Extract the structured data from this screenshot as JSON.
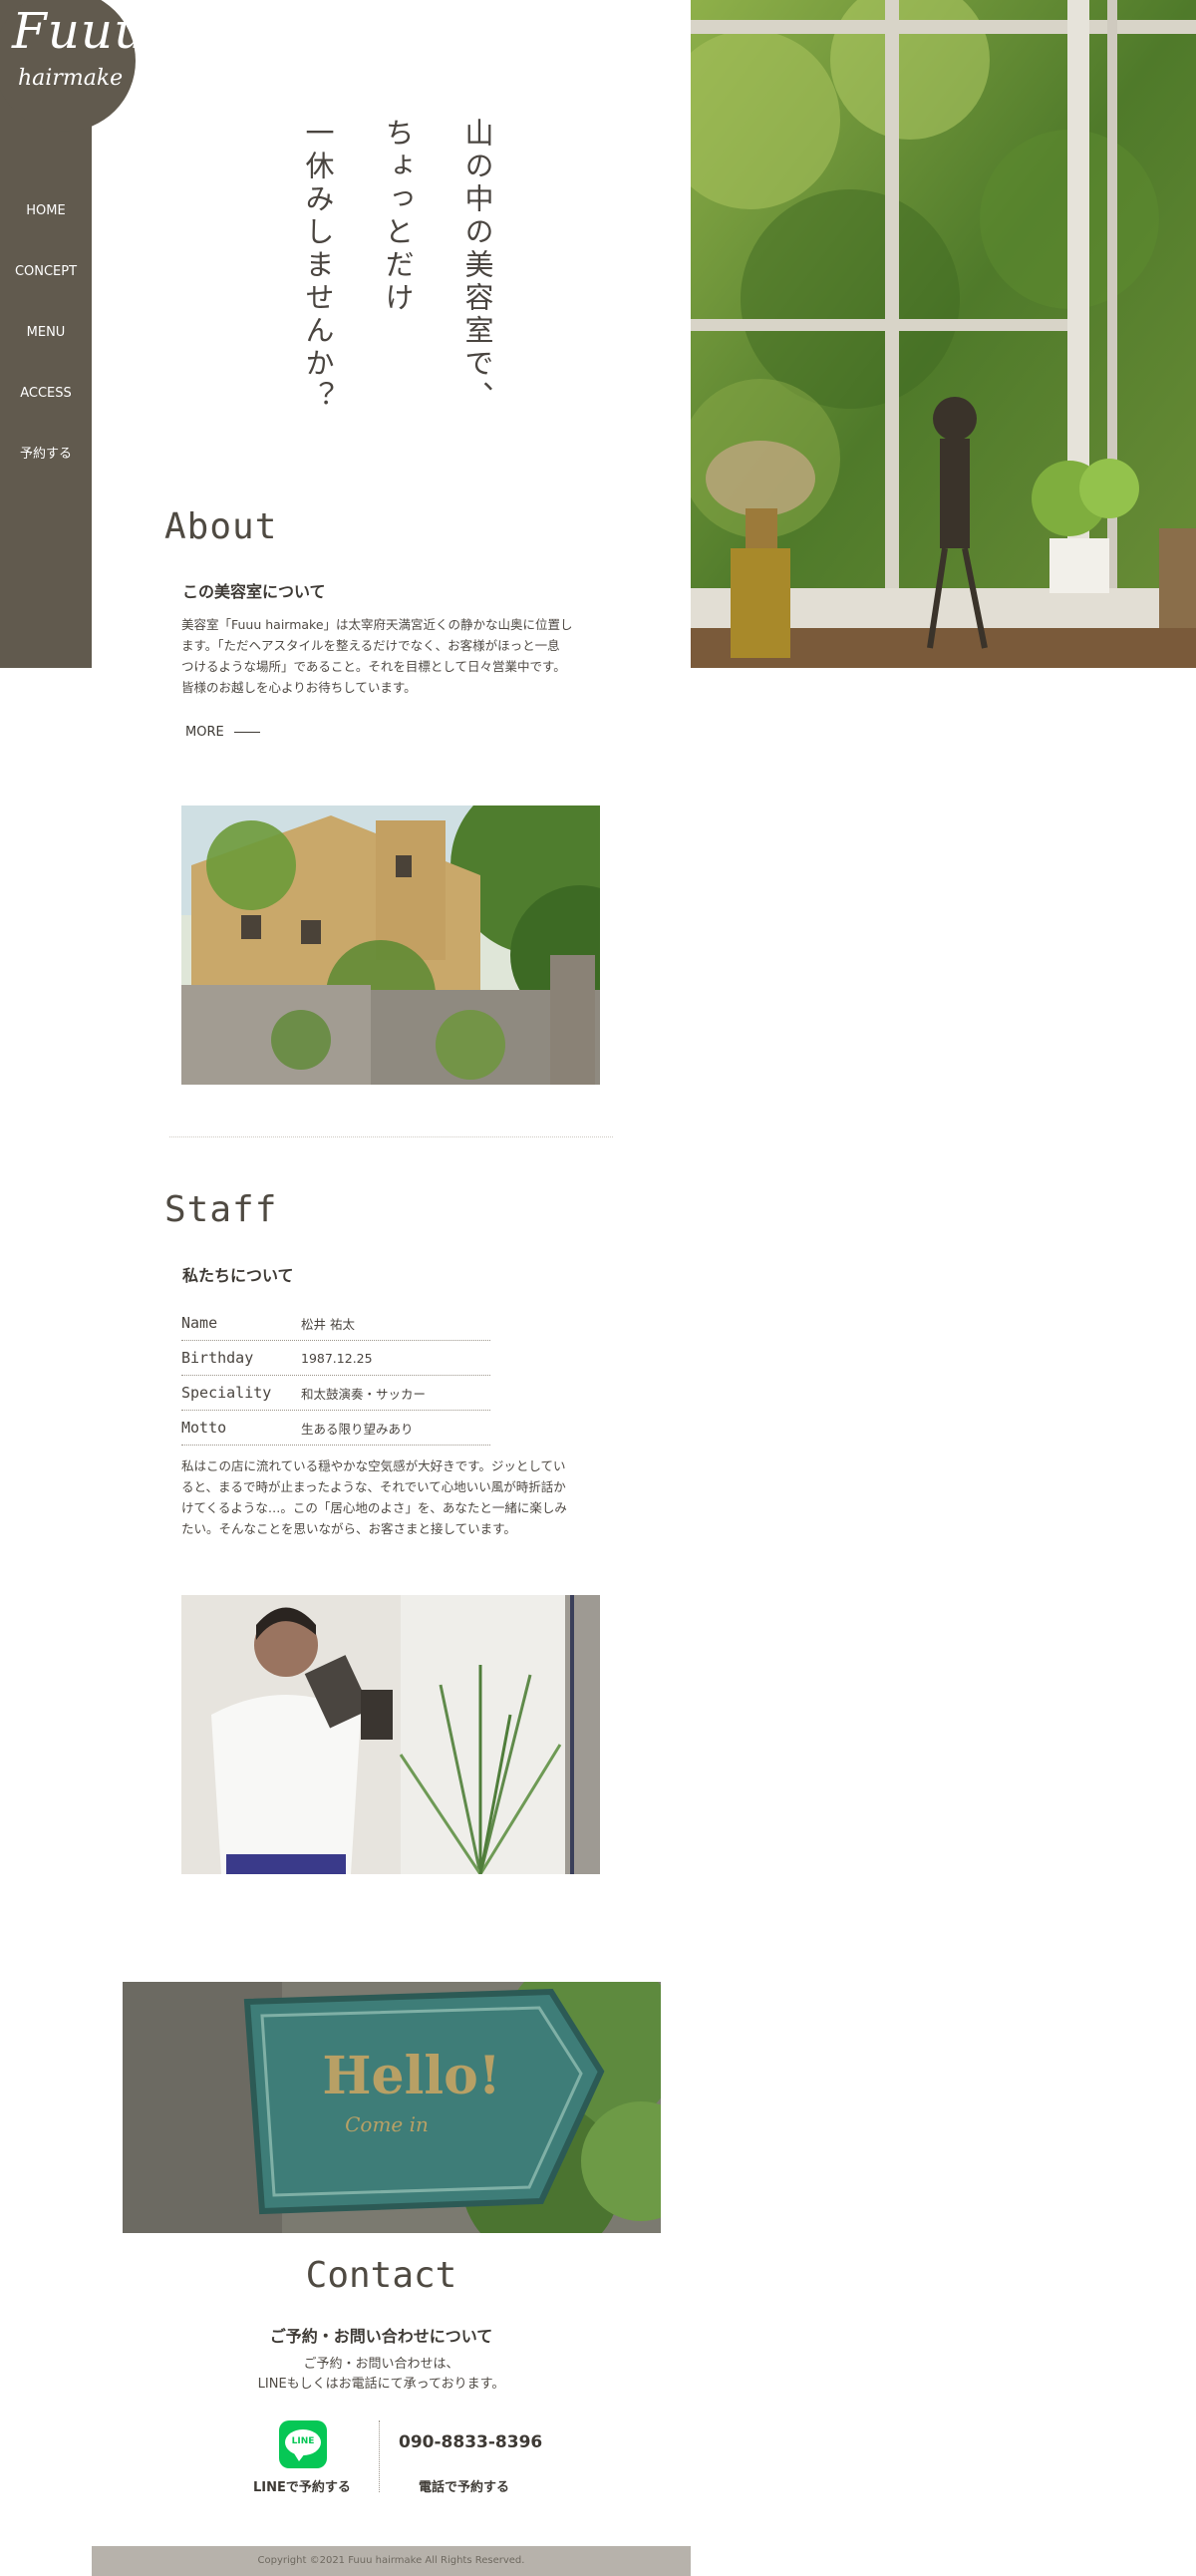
{
  "brand": {
    "logo_main": "Fuuu",
    "logo_sub": "hairmake"
  },
  "nav": {
    "items": [
      "HOME",
      "CONCEPT",
      "MENU",
      "ACCESS",
      "予約する"
    ]
  },
  "hero": {
    "catch_lines": [
      "山の中の美容室で、",
      "ちょっとだけ",
      "一休みしませんか？"
    ]
  },
  "about": {
    "title": "About",
    "subtitle": "この美容室について",
    "paragraph_lines": [
      "美容室「Fuuu hairmake」は太宰府天満宮近くの静かな山奥に位置し",
      "ます。「ただヘアスタイルを整えるだけでなく、お客様がほっと一息",
      "つけるような場所」であること。それを目標として日々営業中です。",
      "皆様のお越しを心よりお待ちしています。"
    ],
    "more_label": "MORE"
  },
  "staff": {
    "title": "Staff",
    "subtitle": "私たちについて",
    "profile": [
      {
        "key": "Name",
        "value": "松井 祐太"
      },
      {
        "key": "Birthday",
        "value": "1987.12.25"
      },
      {
        "key": "Speciality",
        "value": "和太鼓演奏・サッカー"
      },
      {
        "key": "Motto",
        "value": "生ある限り望みあり"
      }
    ],
    "paragraph_lines": [
      "私はこの店に流れている穏やかな空気感が大好きです。ジッとしてい",
      "ると、まるで時が止まったような、それでいて心地いい風が時折話か",
      "けてくるような…。この「居心地のよさ」を、あなたと一緒に楽しみ",
      "たい。そんなことを思いながら、お客さまと接しています。"
    ]
  },
  "contact": {
    "sign_text": "Hello!",
    "sign_sub": "Come in",
    "title": "Contact",
    "subtitle": "ご予約・お問い合わせについて",
    "text_lines": [
      "ご予約・お問い合わせは、",
      "LINEもしくはお電話にて承っております。"
    ],
    "line_icon_text": "LINE",
    "line_label": "LINEで予約する",
    "phone": "090-8833-8396",
    "phone_label": "電話で予約する"
  },
  "footer": {
    "copyright": "Copyright ©2021 Fuuu hairmake All Rights Reserved."
  },
  "colors": {
    "sidebar": "#615a4e",
    "line_green": "#06c755",
    "footer": "#b7b2ab"
  }
}
